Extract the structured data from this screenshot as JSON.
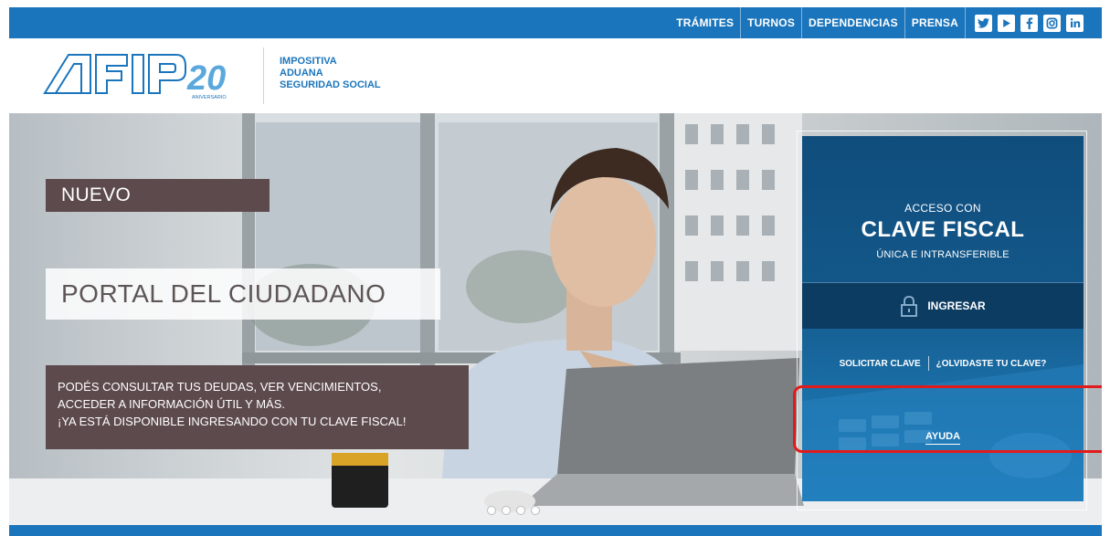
{
  "topnav": {
    "links": [
      "TRÁMITES",
      "TURNOS",
      "DEPENDENCIAS",
      "PRENSA"
    ],
    "social_icons": [
      "twitter-icon",
      "youtube-icon",
      "facebook-icon",
      "instagram-icon",
      "linkedin-icon"
    ]
  },
  "header": {
    "logo_text": "AFIP",
    "logo_badge_number": "20",
    "logo_badge_text": "ANIVERSARIO",
    "tagline": [
      "IMPOSITIVA",
      "ADUANA",
      "SEGURIDAD SOCIAL"
    ]
  },
  "hero": {
    "nuevo": "NUEVO",
    "portal": "PORTAL DEL CIUDADANO",
    "info_lines": [
      "PODÉS CONSULTAR TUS DEUDAS, VER VENCIMIENTOS,",
      "ACCEDER A INFORMACIÓN ÚTIL Y MÁS.",
      "¡YA ESTÁ DISPONIBLE INGRESANDO CON TU CLAVE FISCAL!"
    ],
    "carousel_dots": 4
  },
  "login": {
    "title_small": "ACCESO CON",
    "title_big": "CLAVE FISCAL",
    "subtitle": "ÚNICA E INTRANSFERIBLE",
    "ingresar": "INGRESAR",
    "solicitar": "SOLICITAR CLAVE",
    "olvidaste": "¿OLVIDASTE TU CLAVE?",
    "ayuda": "AYUDA"
  },
  "colors": {
    "brand_blue": "#1b75bc",
    "panel_dark": "#0d3c63",
    "banner_brown": "#5d4a4c",
    "highlight_red": "#e11b1b"
  }
}
